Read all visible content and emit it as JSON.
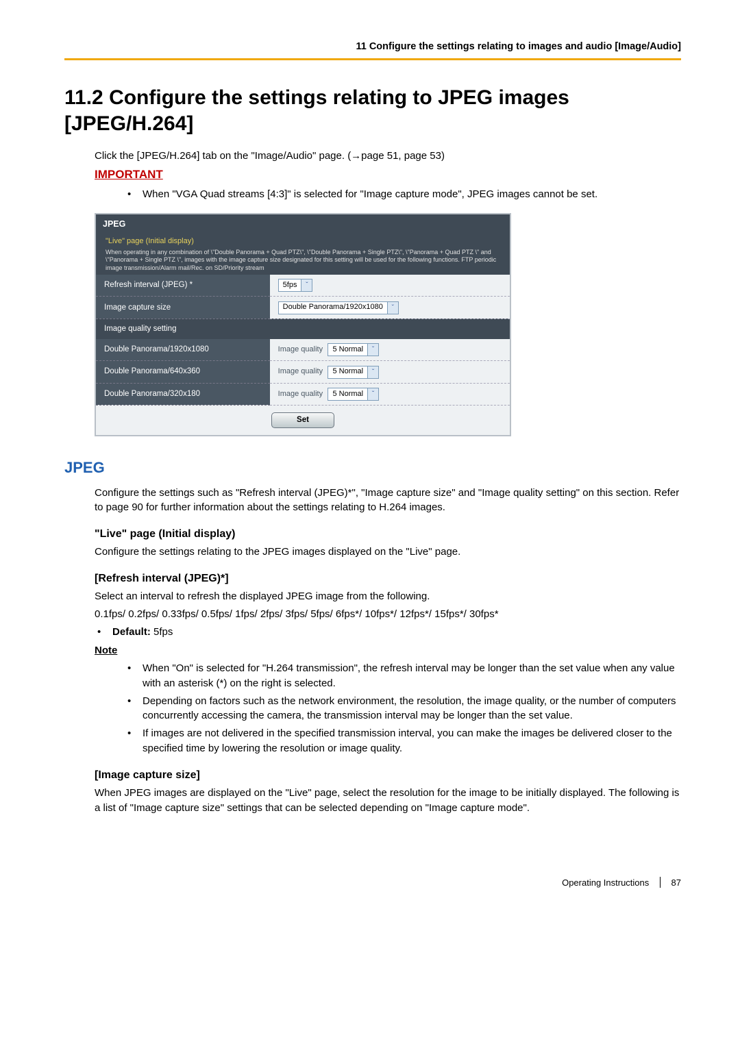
{
  "header": {
    "breadcrumb": "11 Configure the settings relating to images and audio [Image/Audio]"
  },
  "title": "11.2  Configure the settings relating to JPEG images [JPEG/H.264]",
  "intro": "Click the [JPEG/H.264] tab on the \"Image/Audio\" page. (→page 51, page 53)",
  "important_label": "IMPORTANT",
  "important_items": [
    "When \"VGA Quad streams [4:3]\" is selected for \"Image capture mode\", JPEG images cannot be set."
  ],
  "panel": {
    "title": "JPEG",
    "sub_title": "\"Live\" page (Initial display)",
    "sub_desc": "When operating in any combination of \\\"Double Panorama + Quad PTZ\\\", \\\"Double Panorama + Single PTZ\\\", \\\"Panorama + Quad PTZ \\\" and \\\"Panorama + Single PTZ \\\", images with the image capture size designated for this setting will be used for the following functions. FTP periodic image transmission/Alarm mail/Rec. on SD/Priority stream",
    "rows": [
      {
        "label": "Refresh interval (JPEG) *",
        "value": "5fps"
      },
      {
        "label": "Image capture size",
        "value": "Double Panorama/1920x1080"
      }
    ],
    "section2": "Image quality setting",
    "iq_rows": [
      {
        "label": "Double Panorama/1920x1080",
        "prefix": "Image quality",
        "value": "5 Normal"
      },
      {
        "label": "Double Panorama/640x360",
        "prefix": "Image quality",
        "value": "5 Normal"
      },
      {
        "label": "Double Panorama/320x180",
        "prefix": "Image quality",
        "value": "5 Normal"
      }
    ],
    "set": "Set"
  },
  "jpeg_heading": "JPEG",
  "jpeg_intro": "Configure the settings such as \"Refresh interval (JPEG)*\", \"Image capture size\" and \"Image quality setting\" on this section. Refer to page 90 for further information about the settings relating to H.264 images.",
  "live_h": "\"Live\" page (Initial display)",
  "live_p": "Configure the settings relating to the JPEG images displayed on the \"Live\" page.",
  "refresh_h": "[Refresh interval (JPEG)*]",
  "refresh_p1": "Select an interval to refresh the displayed JPEG image from the following.",
  "refresh_p2": "0.1fps/ 0.2fps/ 0.33fps/ 0.5fps/ 1fps/ 2fps/ 3fps/ 5fps/ 6fps*/ 10fps*/ 12fps*/ 15fps*/ 30fps*",
  "default_label": "Default:",
  "default_val": " 5fps",
  "note_label": "Note",
  "note_items": [
    "When \"On\" is selected for \"H.264 transmission\", the refresh interval may be longer than the set value when any value with an asterisk (*) on the right is selected.",
    "Depending on factors such as the network environment, the resolution, the image quality, or the number of computers concurrently accessing the camera, the transmission interval may be longer than the set value.",
    "If images are not delivered in the specified transmission interval, you can make the images be delivered closer to the specified time by lowering the resolution or image quality."
  ],
  "capsize_h": "[Image capture size]",
  "capsize_p": "When JPEG images are displayed on the \"Live\" page, select the resolution for the image to be initially displayed. The following is a list of \"Image capture size\" settings that can be selected depending on \"Image capture mode\".",
  "footer": {
    "label": "Operating Instructions",
    "page": "87"
  }
}
